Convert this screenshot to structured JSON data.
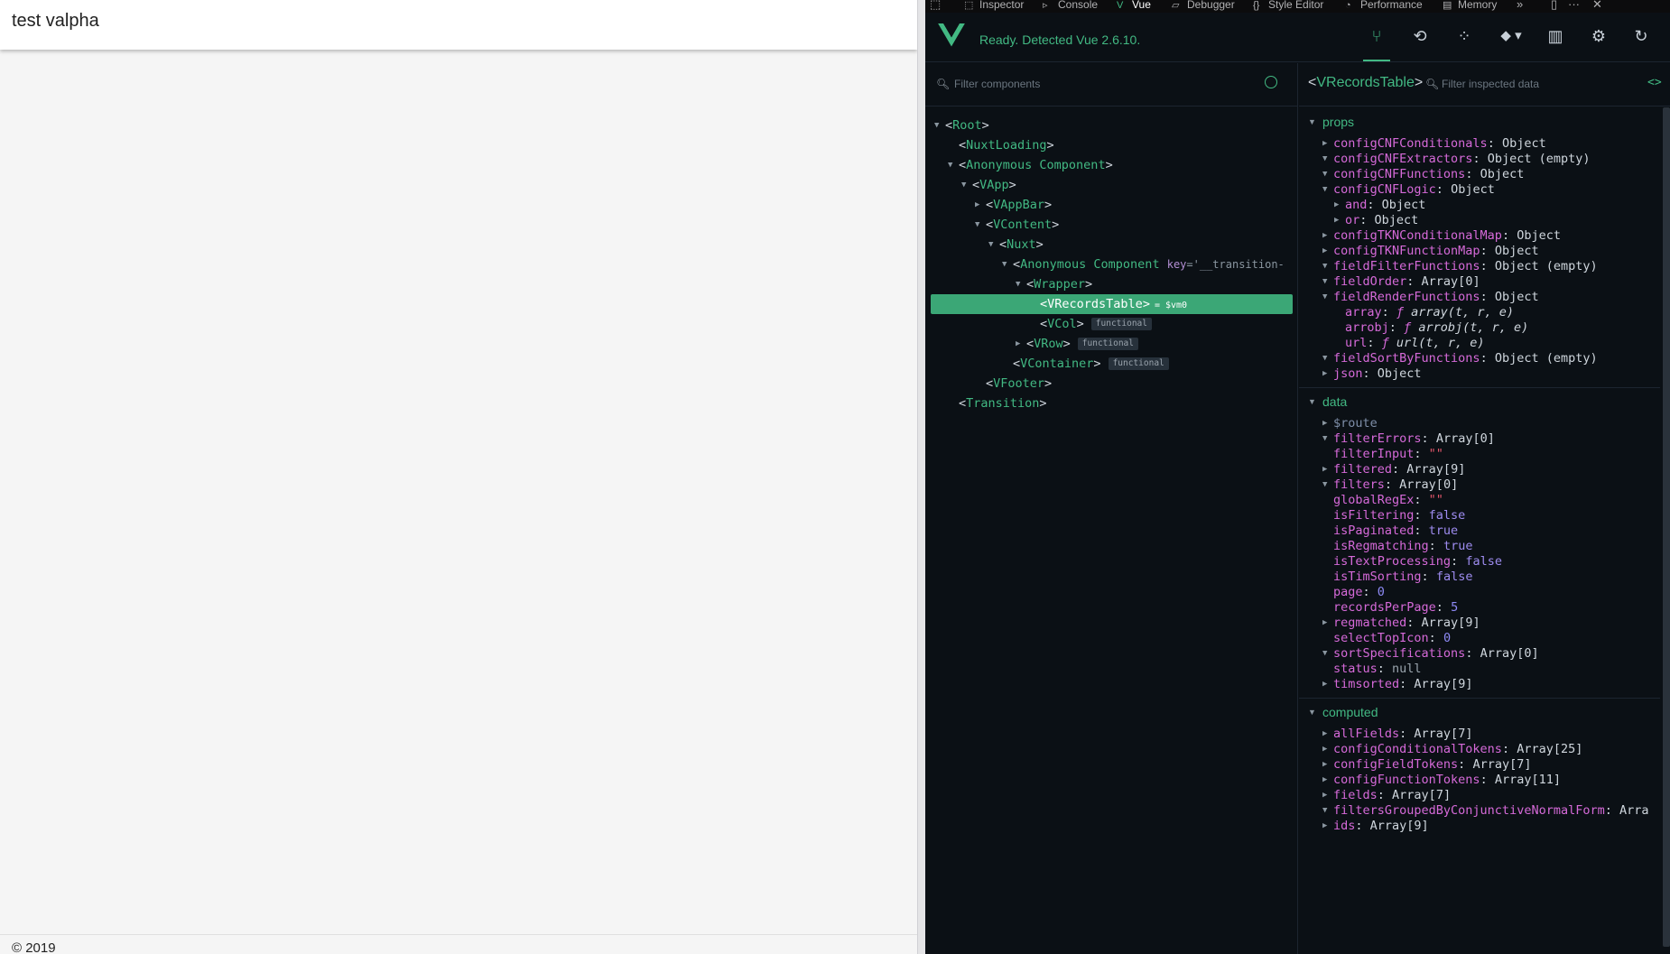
{
  "app": {
    "title": "test valpha",
    "footer": "© 2019"
  },
  "devtools": {
    "tabs": [
      {
        "label": "Inspector",
        "icon": "inspector-icon"
      },
      {
        "label": "Console",
        "icon": "console-icon"
      },
      {
        "label": "Vue",
        "icon": "vue-logo-icon",
        "active": true
      },
      {
        "label": "Debugger",
        "icon": "debugger-icon"
      },
      {
        "label": "Style Editor",
        "icon": "style-editor-icon"
      },
      {
        "label": "Performance",
        "icon": "performance-icon"
      },
      {
        "label": "Memory",
        "icon": "memory-icon"
      }
    ],
    "overflow_glyph": "»",
    "more_glyph": "···",
    "close_glyph": "✕",
    "dock_glyph": "▯"
  },
  "vue": {
    "status": "Ready. Detected Vue 2.6.10.",
    "accent": "#42b983",
    "toolbar": [
      {
        "name": "components-tab",
        "glyph": "⑂",
        "active": true
      },
      {
        "name": "vuex-tab",
        "glyph": "⟲"
      },
      {
        "name": "events-tab",
        "glyph": "⁘"
      },
      {
        "name": "routing-tab",
        "glyph": "◆ ▾"
      },
      {
        "name": "performance-tab",
        "glyph": "▥"
      },
      {
        "name": "settings-tab",
        "glyph": "⚙"
      },
      {
        "name": "refresh-button",
        "glyph": "↻"
      }
    ],
    "filter_components_placeholder": "Filter components",
    "filter_data_placeholder": "Filter inspected data",
    "code_glyph": "<>",
    "selected_component": "VRecordsTable",
    "tree": [
      {
        "tag": "Root",
        "depth": 0,
        "arrow": "▼"
      },
      {
        "tag": "NuxtLoading",
        "depth": 1,
        "arrow": ""
      },
      {
        "tag": "Anonymous Component",
        "depth": 1,
        "arrow": "▼"
      },
      {
        "tag": "VApp",
        "depth": 2,
        "arrow": "▼"
      },
      {
        "tag": "VAppBar",
        "depth": 3,
        "arrow": "▶"
      },
      {
        "tag": "VContent",
        "depth": 3,
        "arrow": "▼"
      },
      {
        "tag": "Nuxt",
        "depth": 4,
        "arrow": "▼"
      },
      {
        "tag": "Anonymous Component",
        "depth": 5,
        "arrow": "▼",
        "attr_key": "key",
        "attr_val": "='__transition-"
      },
      {
        "tag": "Wrapper",
        "depth": 6,
        "arrow": "▼"
      },
      {
        "tag": "VRecordsTable",
        "depth": 7,
        "arrow": "",
        "selected": true,
        "vm": "= $vm0"
      },
      {
        "tag": "VCol",
        "depth": 7,
        "arrow": "",
        "badge": "functional"
      },
      {
        "tag": "VRow",
        "depth": 6,
        "arrow": "▶",
        "badge": "functional"
      },
      {
        "tag": "VContainer",
        "depth": 5,
        "arrow": "",
        "badge": "functional"
      },
      {
        "tag": "VFooter",
        "depth": 3,
        "arrow": ""
      },
      {
        "tag": "Transition",
        "depth": 1,
        "arrow": ""
      }
    ],
    "sections": [
      {
        "title": "props",
        "items": [
          {
            "key": "configCNFConditionals",
            "value": "Object",
            "type": "obj",
            "arrow": "▶",
            "indent": 0
          },
          {
            "key": "configCNFExtractors",
            "value": "Object (empty)",
            "type": "obj",
            "arrow": "▼",
            "indent": 0
          },
          {
            "key": "configCNFFunctions",
            "value": "Object",
            "type": "obj",
            "arrow": "▼",
            "indent": 0
          },
          {
            "key": "configCNFLogic",
            "value": "Object",
            "type": "obj",
            "arrow": "▼",
            "indent": 0
          },
          {
            "key": "and",
            "value": "Object",
            "type": "obj",
            "arrow": "▶",
            "indent": 1
          },
          {
            "key": "or",
            "value": "Object",
            "type": "obj",
            "arrow": "▶",
            "indent": 1
          },
          {
            "key": "configTKNConditionalMap",
            "value": "Object",
            "type": "obj",
            "arrow": "▶",
            "indent": 0
          },
          {
            "key": "configTKNFunctionMap",
            "value": "Object",
            "type": "obj",
            "arrow": "▶",
            "indent": 0
          },
          {
            "key": "fieldFilterFunctions",
            "value": "Object (empty)",
            "type": "obj",
            "arrow": "▼",
            "indent": 0
          },
          {
            "key": "fieldOrder",
            "value": "Array[0]",
            "type": "obj",
            "arrow": "▼",
            "indent": 0
          },
          {
            "key": "fieldRenderFunctions",
            "value": "Object",
            "type": "obj",
            "arrow": "▼",
            "indent": 0
          },
          {
            "key": "array",
            "value": "array(t, r, e)",
            "type": "fn",
            "arrow": "",
            "indent": 1
          },
          {
            "key": "arrobj",
            "value": "arrobj(t, r, e)",
            "type": "fn",
            "arrow": "",
            "indent": 1
          },
          {
            "key": "url",
            "value": "url(t, r, e)",
            "type": "fn",
            "arrow": "",
            "indent": 1
          },
          {
            "key": "fieldSortByFunctions",
            "value": "Object (empty)",
            "type": "obj",
            "arrow": "▼",
            "indent": 0
          },
          {
            "key": "json",
            "value": "Object",
            "type": "obj",
            "arrow": "▶",
            "indent": 0
          }
        ]
      },
      {
        "title": "data",
        "items": [
          {
            "key": "$route",
            "value": "",
            "type": "dim",
            "arrow": "▶",
            "indent": 0
          },
          {
            "key": "filterErrors",
            "value": "Array[0]",
            "type": "obj",
            "arrow": "▼",
            "indent": 0
          },
          {
            "key": "filterInput",
            "value": "\"\"",
            "type": "str",
            "arrow": "",
            "indent": 0
          },
          {
            "key": "filtered",
            "value": "Array[9]",
            "type": "obj",
            "arrow": "▶",
            "indent": 0
          },
          {
            "key": "filters",
            "value": "Array[0]",
            "type": "obj",
            "arrow": "▼",
            "indent": 0
          },
          {
            "key": "globalRegEx",
            "value": "\"\"",
            "type": "str",
            "arrow": "",
            "indent": 0
          },
          {
            "key": "isFiltering",
            "value": "false",
            "type": "bool",
            "arrow": "",
            "indent": 0
          },
          {
            "key": "isPaginated",
            "value": "true",
            "type": "bool",
            "arrow": "",
            "indent": 0
          },
          {
            "key": "isRegmatching",
            "value": "true",
            "type": "bool",
            "arrow": "",
            "indent": 0
          },
          {
            "key": "isTextProcessing",
            "value": "false",
            "type": "bool",
            "arrow": "",
            "indent": 0
          },
          {
            "key": "isTimSorting",
            "value": "false",
            "type": "bool",
            "arrow": "",
            "indent": 0
          },
          {
            "key": "page",
            "value": "0",
            "type": "num",
            "arrow": "",
            "indent": 0
          },
          {
            "key": "recordsPerPage",
            "value": "5",
            "type": "num",
            "arrow": "",
            "indent": 0
          },
          {
            "key": "regmatched",
            "value": "Array[9]",
            "type": "obj",
            "arrow": "▶",
            "indent": 0
          },
          {
            "key": "selectTopIcon",
            "value": "0",
            "type": "num",
            "arrow": "",
            "indent": 0
          },
          {
            "key": "sortSpecifications",
            "value": "Array[0]",
            "type": "obj",
            "arrow": "▼",
            "indent": 0
          },
          {
            "key": "status",
            "value": "null",
            "type": "null",
            "arrow": "",
            "indent": 0
          },
          {
            "key": "timsorted",
            "value": "Array[9]",
            "type": "obj",
            "arrow": "▶",
            "indent": 0
          }
        ]
      },
      {
        "title": "computed",
        "items": [
          {
            "key": "allFields",
            "value": "Array[7]",
            "type": "obj",
            "arrow": "▶",
            "indent": 0
          },
          {
            "key": "configConditionalTokens",
            "value": "Array[25]",
            "type": "obj",
            "arrow": "▶",
            "indent": 0
          },
          {
            "key": "configFieldTokens",
            "value": "Array[7]",
            "type": "obj",
            "arrow": "▶",
            "indent": 0
          },
          {
            "key": "configFunctionTokens",
            "value": "Array[11]",
            "type": "obj",
            "arrow": "▶",
            "indent": 0
          },
          {
            "key": "fields",
            "value": "Array[7]",
            "type": "obj",
            "arrow": "▶",
            "indent": 0
          },
          {
            "key": "filtersGroupedByConjunctiveNormalForm",
            "value": "Arra",
            "type": "obj",
            "arrow": "▼",
            "indent": 0
          },
          {
            "key": "ids",
            "value": "Array[9]",
            "type": "obj",
            "arrow": "▶",
            "indent": 0
          }
        ]
      }
    ]
  }
}
